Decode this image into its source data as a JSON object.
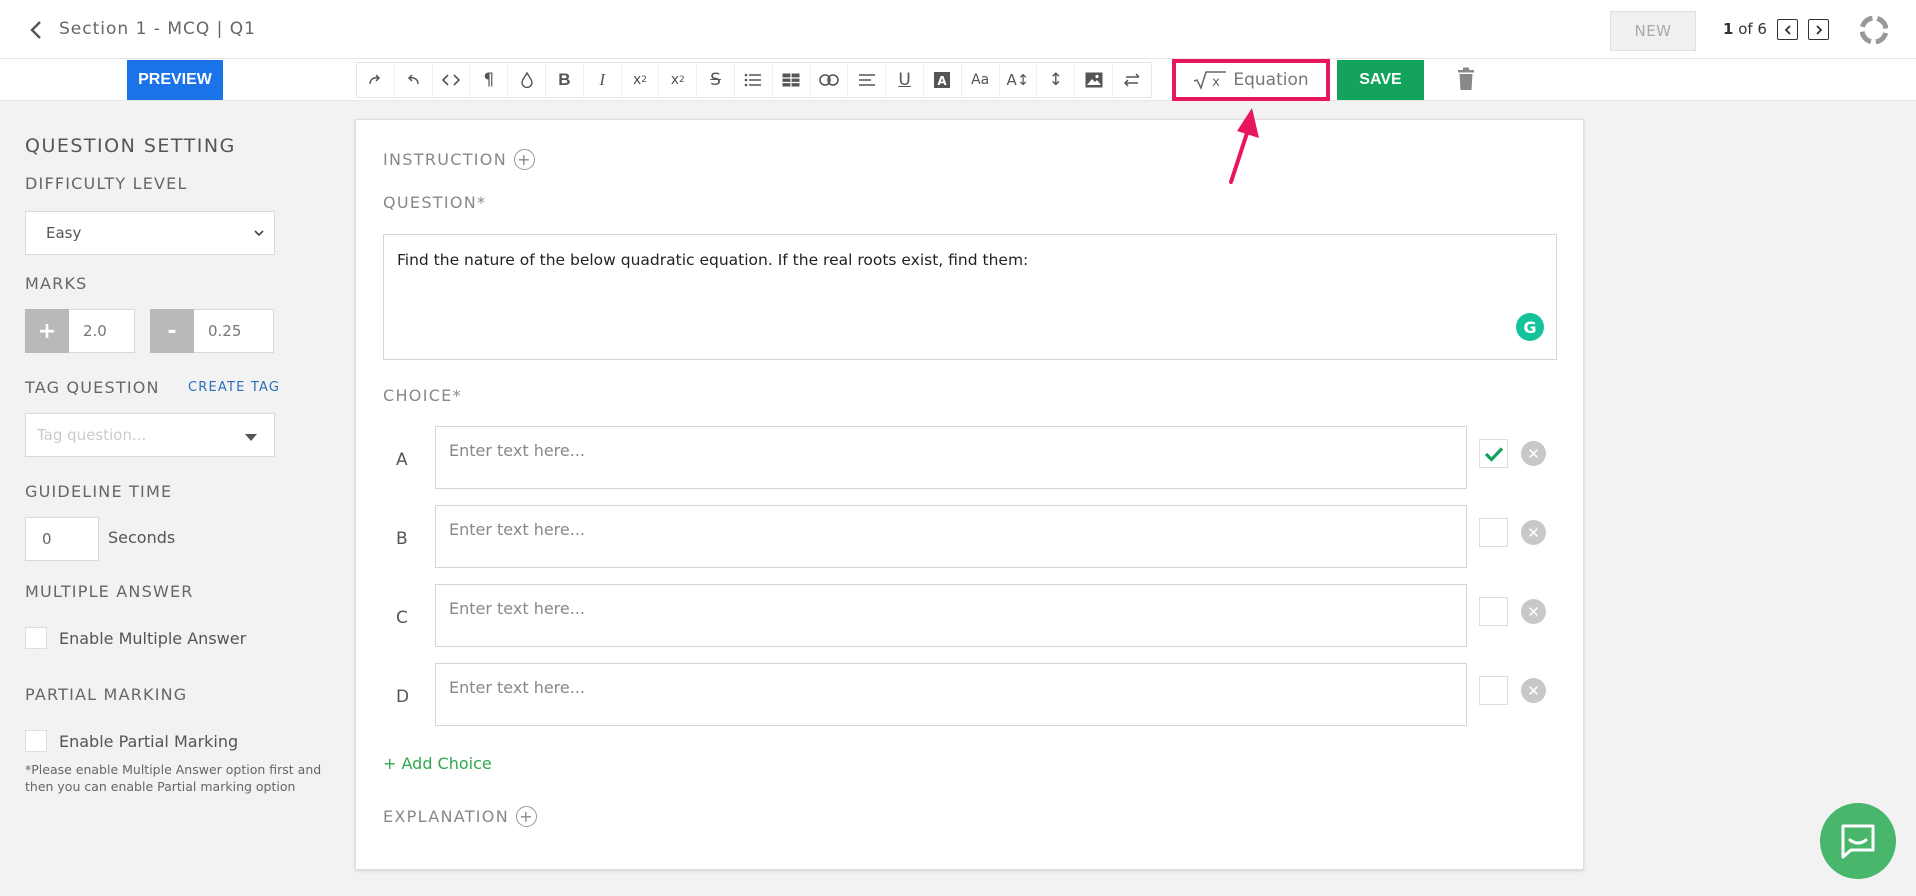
{
  "header": {
    "breadcrumb": "Section 1 - MCQ | Q1",
    "new_label": "NEW",
    "pager_current": "1",
    "pager_total": " of 6"
  },
  "toolbar": {
    "preview_label": "PREVIEW",
    "tools": [
      "redo-icon",
      "undo-icon",
      "code-icon",
      "paragraph-icon",
      "color-drop-icon",
      "bold-icon",
      "italic-icon",
      "superscript-icon",
      "subscript-icon",
      "strikethrough-icon",
      "bullet-list-icon",
      "table-icon",
      "link-icon",
      "align-icon",
      "underline-icon",
      "text-color-icon",
      "font-size-icon",
      "line-height-icon",
      "vertical-resize-icon",
      "image-icon",
      "swap-icon"
    ],
    "equation_label": "Equation",
    "save_label": "SAVE"
  },
  "sidebar": {
    "title": "QUESTION SETTING",
    "difficulty_label": "DIFFICULTY LEVEL",
    "difficulty_value": "Easy",
    "marks_label": "MARKS",
    "marks_plus_sign": "+",
    "marks_plus_value": "2.0",
    "marks_minus_sign": "-",
    "marks_minus_value": "0.25",
    "tag_label": "TAG QUESTION",
    "create_tag": "CREATE TAG",
    "tag_placeholder": "Tag question...",
    "guideline_label": "GUIDELINE TIME",
    "guideline_value": "0",
    "guideline_unit": "Seconds",
    "multiple_label": "MULTIPLE ANSWER",
    "multiple_checkbox": "Enable Multiple Answer",
    "partial_label": "PARTIAL MARKING",
    "partial_checkbox": "Enable Partial Marking",
    "note": "*Please enable Multiple Answer option first and then you can enable Partial marking option"
  },
  "main": {
    "instruction_label": "INSTRUCTION",
    "question_label": "QUESTION*",
    "question_text": "Find the nature of the below quadratic equation. If the real roots exist, find them:",
    "choice_label": "CHOICE*",
    "choices": [
      {
        "letter": "A",
        "placeholder": "Enter text here...",
        "correct": true
      },
      {
        "letter": "B",
        "placeholder": "Enter text here...",
        "correct": false
      },
      {
        "letter": "C",
        "placeholder": "Enter text here...",
        "correct": false
      },
      {
        "letter": "D",
        "placeholder": "Enter text here...",
        "correct": false
      }
    ],
    "add_choice": "+ Add Choice",
    "explanation_label": "EXPLANATION"
  },
  "colors": {
    "preview": "#1a73e8",
    "save": "#13a35a",
    "highlight": "#e8175d",
    "check": "#13a35a",
    "chat": "#48b66b"
  }
}
